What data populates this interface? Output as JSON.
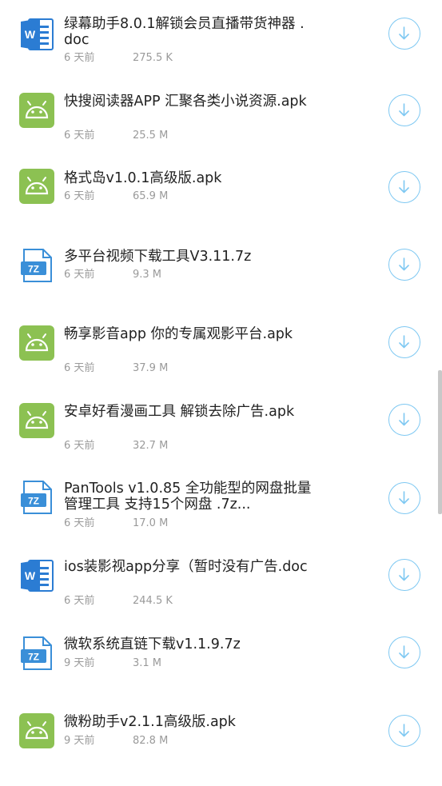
{
  "files": [
    {
      "icon": "word-doc-icon",
      "name": "绿幕助手8.0.1解锁会员直播带货神器 .doc",
      "time": "6 天前",
      "size": "275.5 K"
    },
    {
      "icon": "android-apk-icon",
      "name": "快搜阅读器APP 汇聚各类小说资源.apk",
      "time": "6 天前",
      "size": "25.5 M"
    },
    {
      "icon": "android-apk-icon",
      "name": "格式岛v1.0.1高级版.apk",
      "time": "6 天前",
      "size": "65.9 M"
    },
    {
      "icon": "7z-archive-icon",
      "name": "多平台视频下载工具V3.11.7z",
      "time": "6 天前",
      "size": "9.3 M"
    },
    {
      "icon": "android-apk-icon",
      "name": "畅享影音app 你的专属观影平台.apk",
      "time": "6 天前",
      "size": "37.9 M"
    },
    {
      "icon": "android-apk-icon",
      "name": "安卓好看漫画工具 解锁去除广告.apk",
      "time": "6 天前",
      "size": "32.7 M"
    },
    {
      "icon": "7z-archive-icon",
      "name": "PanTools v1.0.85 全功能型的网盘批量管理工具 支持15个网盘 .7z...",
      "time": "6 天前",
      "size": "17.0 M"
    },
    {
      "icon": "word-doc-icon",
      "name": "ios装影视app分享（暂时没有广告.doc",
      "time": "6 天前",
      "size": "244.5 K"
    },
    {
      "icon": "7z-archive-icon",
      "name": "微软系统直链下载v1.1.9.7z",
      "time": "9 天前",
      "size": "3.1 M"
    },
    {
      "icon": "android-apk-icon",
      "name": "微粉助手v2.1.1高级版.apk",
      "time": "9 天前",
      "size": "82.8 M"
    }
  ],
  "download_icon": "download-arrow-icon",
  "colors": {
    "word": "#2b7cd3",
    "android": "#8cc152",
    "archive": "#3a8fd8",
    "download_ring": "#7ec8f2",
    "title": "#222222",
    "meta": "#9a9a9a"
  }
}
